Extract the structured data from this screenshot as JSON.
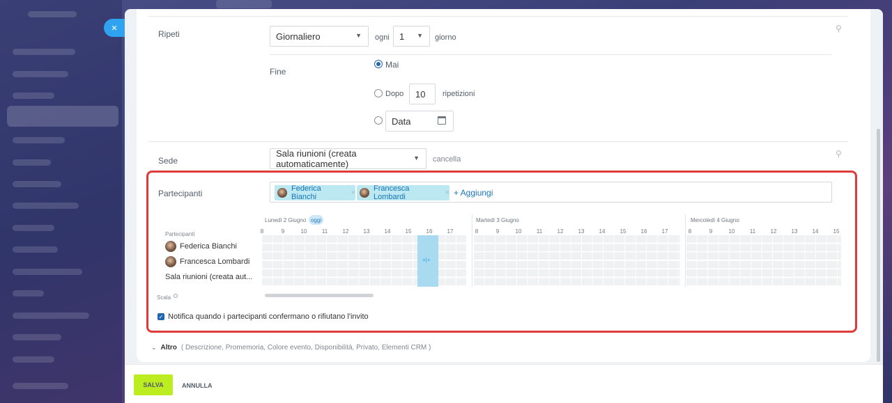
{
  "close_symbol": "×",
  "pin_symbol": "⚲",
  "repeat": {
    "label": "Ripeti",
    "frequency": "Giornaliero",
    "every_label": "ogni",
    "every_value": "1",
    "unit_label": "giorno"
  },
  "end": {
    "label": "Fine",
    "never_label": "Mai",
    "after_label": "Dopo",
    "after_value": "10",
    "after_unit": "ripetizioni",
    "date_placeholder": "Data"
  },
  "location": {
    "label": "Sede",
    "value": "Sala riunioni (creata automaticamente)",
    "cancel_label": "cancella"
  },
  "participants": {
    "label": "Partecipanti",
    "tags": [
      "Federica Bianchi",
      "Francesca Lombardi"
    ],
    "add_label": "+ Aggiungi",
    "remove_symbol": "×"
  },
  "schedule": {
    "participants_header": "Partecipanti",
    "days": [
      "Lunedì 2 Giugno",
      "Martedì 3 Giugno",
      "Mercoledì 4 Giugno"
    ],
    "today_badge": "oggi",
    "hours_day1": [
      "8",
      "9",
      "10",
      "11",
      "12",
      "13",
      "14",
      "15",
      "16",
      "17"
    ],
    "hours_day2": [
      "8",
      "9",
      "10",
      "11",
      "12",
      "13",
      "14",
      "15",
      "16",
      "17"
    ],
    "hours_day3": [
      "8",
      "9",
      "10",
      "11",
      "12",
      "13",
      "14",
      "15"
    ],
    "rows": [
      "Federica Bianchi",
      "Francesca Lombardi",
      "Sala riunioni (creata aut..."
    ],
    "scale_label": "Scala",
    "slot_icon": "+|+"
  },
  "notify": {
    "label": "Notifica quando i partecipanti confermano o rifiutano l'invito",
    "checked": true
  },
  "more": {
    "label": "Altro",
    "items": "( Descrizione,  Promemoria,  Colore evento,  Disponibilità,  Privato,  Elementi CRM )"
  },
  "footer": {
    "save_label": "SALVA",
    "cancel_label": "ANNULLA"
  },
  "colors": {
    "accent": "#2067b0",
    "save_button": "#bbed21",
    "highlight": "#e03b3b",
    "tag_bg": "#bce8f1"
  }
}
